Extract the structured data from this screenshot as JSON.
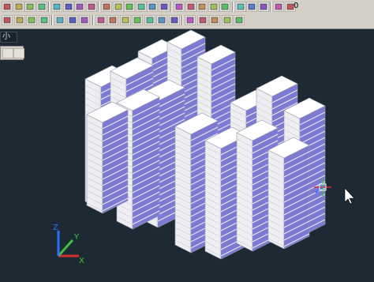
{
  "toolbar": {
    "row1_icons": [
      "layer-manager-icon",
      "layer-state-icon",
      "shade-icon",
      "lock-icon",
      "dims-icon",
      "text-style-icon",
      "dimension-icon",
      "table-icon",
      "box-icon",
      "sphere-icon",
      "cylinder-icon",
      "cone-icon",
      "torus-icon",
      "wedge-icon",
      "cube-icon",
      "union-icon",
      "subtract-icon",
      "intersect-icon",
      "extrude-icon",
      "slice-icon",
      "lamp-icon",
      "sun-icon",
      "freeze-icon",
      "color-swatch-icon"
    ],
    "layer_value": "0",
    "row2_icons": [
      "zoom-icon",
      "pan-icon",
      "orbit-icon",
      "view-cube-icon",
      "render-icon",
      "camera-icon",
      "walk-icon",
      "ucs-world-icon",
      "ucs-origin-icon",
      "ucs-axis-icon",
      "ucs-3point-icon",
      "ucs-view-icon",
      "ucs-object-icon",
      "ucs-face-icon",
      "ucs-apply-icon",
      "ucs-prev-icon",
      "ucs-x-icon",
      "ucs-y-icon",
      "ucs-z-icon"
    ]
  },
  "side": {
    "tab_label": "小"
  },
  "colors": {
    "viewport": "#1e2a33",
    "wall": "#eeeef2",
    "window": "#7d7ad4",
    "accent_red": "#d32f2f",
    "accent_green": "#3fbf3f",
    "accent_blue": "#2f6fff"
  },
  "ucs": {
    "x_label": "X",
    "y_label": "Y",
    "z_label": "Z"
  }
}
